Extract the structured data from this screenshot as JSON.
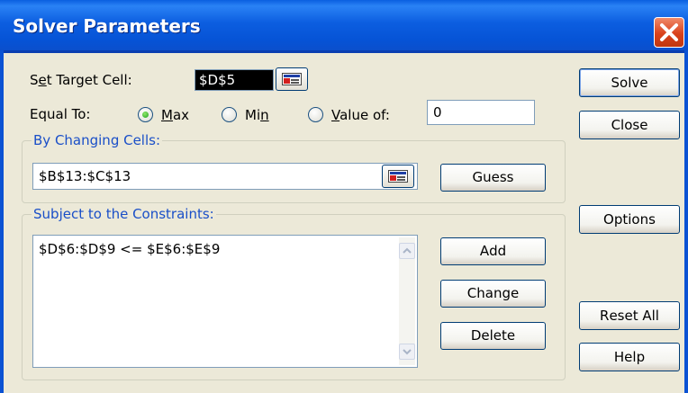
{
  "title": "Solver Parameters",
  "target_cell": {
    "label_pre": "S",
    "label_ul": "e",
    "label_post": "t Target Cell:",
    "value": "$D$5"
  },
  "equal_to": {
    "label": "Equal To:",
    "max": {
      "ul": "M",
      "rest": "ax",
      "checked": true
    },
    "min": {
      "pre": "Mi",
      "ul": "n",
      "checked": false
    },
    "value_of": {
      "ul": "V",
      "rest": "alue of:",
      "checked": false,
      "value": "0"
    }
  },
  "changing_cells": {
    "label_ul": "B",
    "label_rest": "y Changing Cells:",
    "value": "$B$13:$C$13"
  },
  "constraints": {
    "label_pre": "S",
    "label_ul": "u",
    "label_rest": "bject to the Constraints:",
    "items": [
      "$D$6:$D$9 <= $E$6:$E$9"
    ]
  },
  "buttons": {
    "solve": {
      "ul": "S",
      "rest": "olve"
    },
    "close": "Close",
    "guess": {
      "ul": "G",
      "rest": "uess"
    },
    "options": {
      "ul": "O",
      "rest": "ptions"
    },
    "add": {
      "ul": "A",
      "rest": "dd"
    },
    "change": {
      "ul": "C",
      "rest": "hange"
    },
    "delete": {
      "ul": "D",
      "rest": "elete"
    },
    "reset_all": {
      "ul": "R",
      "rest": "eset All"
    },
    "help": {
      "ul": "H",
      "rest": "elp"
    }
  },
  "colors": {
    "title_bar": "#0a5fe0",
    "group_title": "#1a4fc8",
    "face": "#ece9d8",
    "close": "#d9421c"
  },
  "icons": [
    "close-icon",
    "range-select-icon",
    "scroll-up-icon",
    "scroll-down-icon",
    "radio-icon"
  ]
}
